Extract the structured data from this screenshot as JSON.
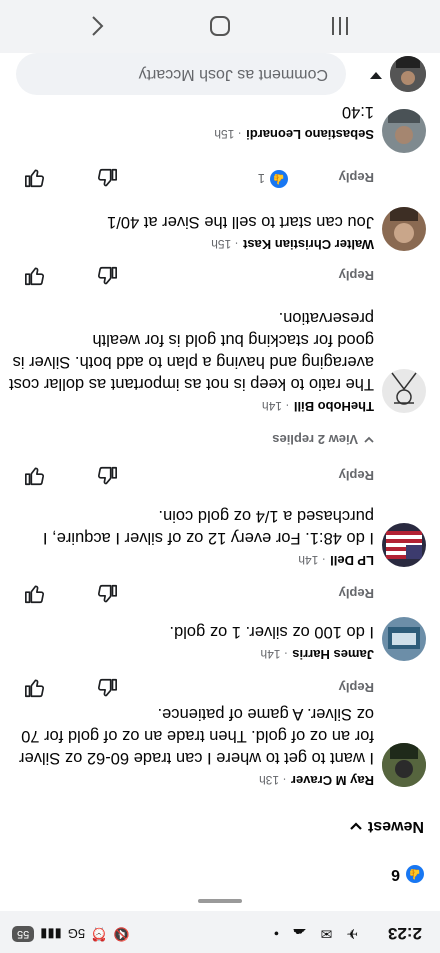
{
  "status_bar": {
    "time": "2:23",
    "signal_text": "5G",
    "battery": "55"
  },
  "reactions": {
    "count": "6"
  },
  "sort": {
    "label": "Newest"
  },
  "comments": [
    {
      "author": "Ray M Craver",
      "time": "13h",
      "text": "I want to get to where I can trade 60-62 oz Silver for an oz of gold. Then trade an oz of gold for 70 oz Silver.  A game of patience.",
      "reply_label": "Reply"
    },
    {
      "author": "James Harris",
      "time": "14h",
      "text": "I do 100 oz silver.  1 oz gold.",
      "reply_label": "Reply"
    },
    {
      "author": "LP Dell",
      "time": "14h",
      "text": "I do 48:1.  For every 12 oz of silver I acquire, I purchased a 1/4 oz gold coin.",
      "reply_label": "Reply",
      "view_replies": "View 2 replies"
    },
    {
      "author": "TheHobo Bill",
      "time": "14h",
      "text": "The ratio to keep is not as important as dollar cost averaging and having a plan to add both. Silver is good for stacking but gold is for wealth preservation.",
      "reply_label": "Reply"
    },
    {
      "author": "Walter Christian Kast",
      "time": "15h",
      "text": "Jou can start to sell the Siver at 40/1",
      "reply_label": "Reply",
      "reaction_count": "1"
    },
    {
      "author": "Sebastiano Leonardi",
      "time": "15h",
      "text": "1:40",
      "reply_label": "Reply"
    }
  ],
  "comment_bar": {
    "placeholder": "Comment as Josh Mccarty"
  },
  "colors": {
    "accent": "#1877f2",
    "secondary_text": "#65676b"
  },
  "icons": [
    "like-icon",
    "thumbs-up-icon",
    "thumbs-down-icon",
    "chevron-down-icon",
    "back-icon",
    "home-icon",
    "recents-icon"
  ]
}
